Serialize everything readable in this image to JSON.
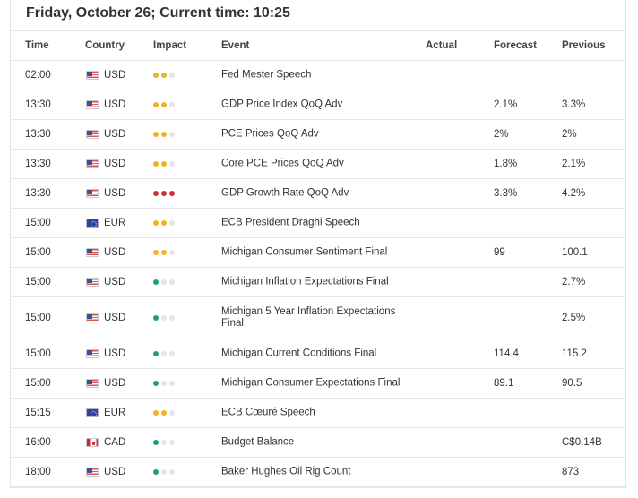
{
  "header": {
    "title": "Friday, October 26; Current time: 10:25"
  },
  "columns": {
    "time": "Time",
    "country": "Country",
    "impact": "Impact",
    "event": "Event",
    "actual": "Actual",
    "forecast": "Forecast",
    "previous": "Previous"
  },
  "colors": {
    "impact_medium": "#f5b024",
    "impact_high": "#d0303a",
    "impact_low": "#1fa06a",
    "impact_off": "#e6e6e6"
  },
  "rows": [
    {
      "time": "02:00",
      "currency": "USD",
      "flag": "us-flag-icon",
      "impact": 2,
      "event": "Fed Mester Speech",
      "actual": "",
      "forecast": "",
      "previous": ""
    },
    {
      "time": "13:30",
      "currency": "USD",
      "flag": "us-flag-icon",
      "impact": 2,
      "event": "GDP Price Index QoQ Adv",
      "actual": "",
      "forecast": "2.1%",
      "previous": "3.3%"
    },
    {
      "time": "13:30",
      "currency": "USD",
      "flag": "us-flag-icon",
      "impact": 2,
      "event": "PCE Prices QoQ Adv",
      "actual": "",
      "forecast": "2%",
      "previous": "2%"
    },
    {
      "time": "13:30",
      "currency": "USD",
      "flag": "us-flag-icon",
      "impact": 2,
      "event": "Core PCE Prices QoQ Adv",
      "actual": "",
      "forecast": "1.8%",
      "previous": "2.1%"
    },
    {
      "time": "13:30",
      "currency": "USD",
      "flag": "us-flag-icon",
      "impact": 3,
      "event": "GDP Growth Rate QoQ Adv",
      "actual": "",
      "forecast": "3.3%",
      "previous": "4.2%"
    },
    {
      "time": "15:00",
      "currency": "EUR",
      "flag": "eu-flag-icon",
      "impact": 2,
      "event": "ECB President Draghi Speech",
      "actual": "",
      "forecast": "",
      "previous": ""
    },
    {
      "time": "15:00",
      "currency": "USD",
      "flag": "us-flag-icon",
      "impact": 2,
      "event": "Michigan Consumer Sentiment Final",
      "actual": "",
      "forecast": "99",
      "previous": "100.1"
    },
    {
      "time": "15:00",
      "currency": "USD",
      "flag": "us-flag-icon",
      "impact": 1,
      "event": "Michigan Inflation Expectations Final",
      "actual": "",
      "forecast": "",
      "previous": "2.7%"
    },
    {
      "time": "15:00",
      "currency": "USD",
      "flag": "us-flag-icon",
      "impact": 1,
      "event": "Michigan 5 Year Inflation Expectations Final",
      "actual": "",
      "forecast": "",
      "previous": "2.5%"
    },
    {
      "time": "15:00",
      "currency": "USD",
      "flag": "us-flag-icon",
      "impact": 1,
      "event": "Michigan Current Conditions Final",
      "actual": "",
      "forecast": "114.4",
      "previous": "115.2"
    },
    {
      "time": "15:00",
      "currency": "USD",
      "flag": "us-flag-icon",
      "impact": 1,
      "event": "Michigan Consumer Expectations Final",
      "actual": "",
      "forecast": "89.1",
      "previous": "90.5"
    },
    {
      "time": "15:15",
      "currency": "EUR",
      "flag": "eu-flag-icon",
      "impact": 2,
      "event": "ECB Cœuré Speech",
      "actual": "",
      "forecast": "",
      "previous": ""
    },
    {
      "time": "16:00",
      "currency": "CAD",
      "flag": "ca-flag-icon",
      "impact": 1,
      "event": "Budget Balance",
      "actual": "",
      "forecast": "",
      "previous": "C$0.14B"
    },
    {
      "time": "18:00",
      "currency": "USD",
      "flag": "us-flag-icon",
      "impact": 1,
      "event": "Baker Hughes Oil Rig Count",
      "actual": "",
      "forecast": "",
      "previous": "873"
    }
  ]
}
